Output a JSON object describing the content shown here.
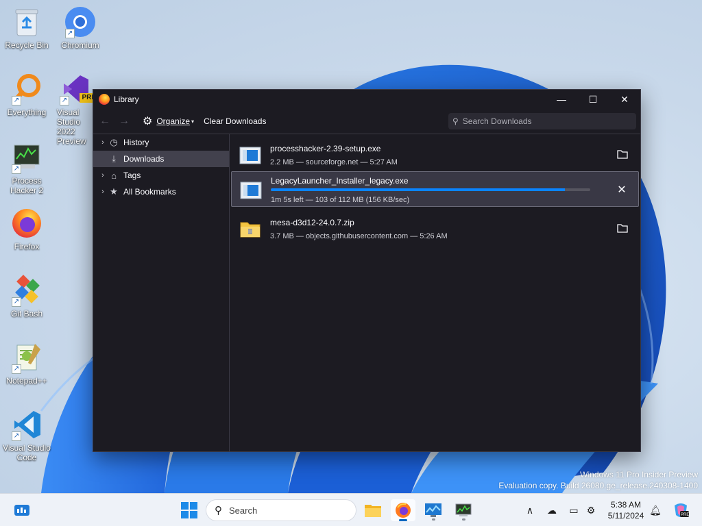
{
  "desktop": {
    "icons": [
      {
        "label": "Recycle Bin",
        "icon": "recycle-bin-icon"
      },
      {
        "label": "Chromium",
        "icon": "chromium-icon"
      },
      {
        "label": "Everything",
        "icon": "everything-search-icon"
      },
      {
        "label": "Visual Studio 2022 Preview",
        "icon": "visual-studio-icon"
      },
      {
        "label": "Process Hacker 2",
        "icon": "process-hacker-icon"
      },
      {
        "label": "Firefox",
        "icon": "firefox-icon"
      },
      {
        "label": "Git Bash",
        "icon": "git-bash-icon"
      },
      {
        "label": "Notepad++",
        "icon": "notepadpp-icon"
      },
      {
        "label": "Visual Studio Code",
        "icon": "vscode-icon"
      }
    ],
    "vs_badge": "PRE",
    "watermark": {
      "line1": "Windows 11 Pro Insider Preview",
      "line2": "Evaluation copy. Build 26080.ge_release.240308-1400"
    }
  },
  "window": {
    "title": "Library",
    "controls": {
      "minimize": "—",
      "maximize": "☐",
      "close": "✕"
    },
    "toolbar": {
      "back": "←",
      "forward": "→",
      "organize_label": "Organize",
      "clear_label": "Clear Downloads",
      "search_placeholder": "Search Downloads"
    },
    "sidebar": [
      {
        "label": "History",
        "icon": "clock-icon",
        "expandable": true
      },
      {
        "label": "Downloads",
        "icon": "download-icon",
        "expandable": false,
        "selected": true
      },
      {
        "label": "Tags",
        "icon": "tag-icon",
        "expandable": true
      },
      {
        "label": "All Bookmarks",
        "icon": "star-icon",
        "expandable": true
      }
    ],
    "downloads": [
      {
        "name": "processhacker-2.39-setup.exe",
        "status": "2.2 MB — sourceforge.net — 5:27 AM",
        "icon": "exe-file-icon",
        "action": "open-folder-icon"
      },
      {
        "name": "LegacyLauncher_Installer_legacy.exe",
        "status": "1m 5s left — 103 of 112 MB (156 KB/sec)",
        "icon": "exe-file-icon",
        "action": "cancel-icon",
        "progress": 0.92
      },
      {
        "name": "mesa-d3d12-24.0.7.zip",
        "status": "3.7 MB — objects.githubusercontent.com — 5:26 AM",
        "icon": "zip-file-icon",
        "action": "open-folder-icon"
      }
    ]
  },
  "taskbar": {
    "search_placeholder": "Search",
    "time": "5:38 AM",
    "date": "5/11/2024",
    "apps": [
      "file-explorer-icon",
      "firefox-icon",
      "monitor-app-icon",
      "process-hacker-icon"
    ],
    "tray": [
      "chevron-up-icon",
      "cloud-off-icon",
      "display-icon",
      "network-icon",
      "bell-icon",
      "copilot-icon"
    ]
  },
  "colors": {
    "accent": "#0a84ff",
    "window_bg": "#1c1b22",
    "selected_row": "#42414d"
  }
}
